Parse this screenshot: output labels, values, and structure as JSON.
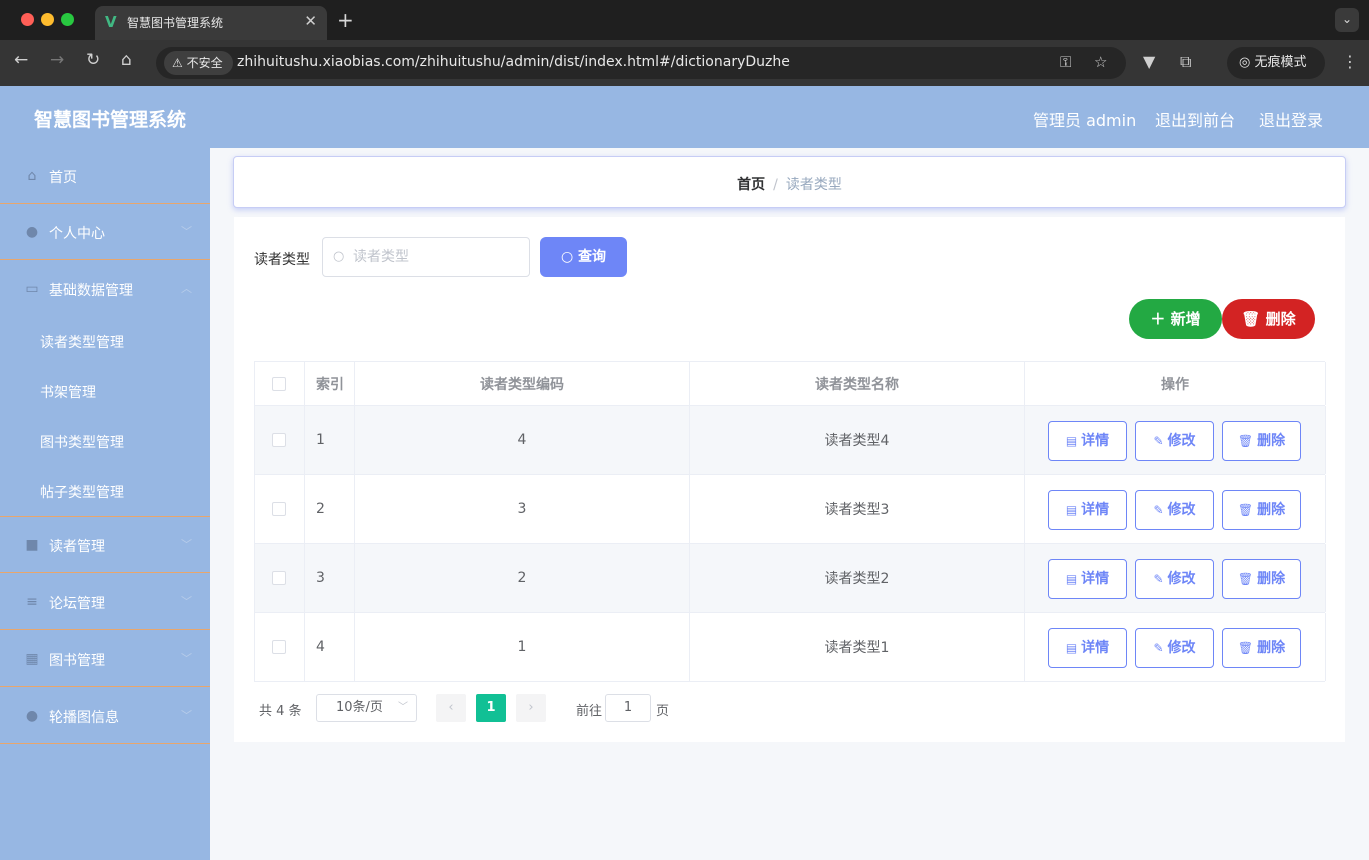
{
  "browser": {
    "tab_title": "智慧图书管理系统",
    "tab_icon": "vue-logo-icon",
    "new_tab_label": "+",
    "security_label": "不安全",
    "url": "zhihuitushu.xiaobias.com/zhihuitushu/admin/dist/index.html#/dictionaryDuzhe",
    "incognito_label": "无痕模式"
  },
  "header": {
    "title": "智慧图书管理系统",
    "user_label": "管理员 admin",
    "back_front_label": "退出到前台",
    "logout_label": "退出登录",
    "bg_color": "#97b7e3"
  },
  "sidebar": {
    "items": [
      {
        "label": "首页",
        "icon": "home-icon"
      },
      {
        "label": "个人中心",
        "icon": "user-icon"
      },
      {
        "label": "基础数据管理",
        "icon": "chat-icon"
      },
      {
        "label": "读者管理",
        "icon": "briefcase-icon"
      },
      {
        "label": "论坛管理",
        "icon": "list-icon"
      },
      {
        "label": "图书管理",
        "icon": "grid-icon"
      },
      {
        "label": "轮播图信息",
        "icon": "bulb-icon"
      }
    ],
    "sub_items": [
      {
        "label": "读者类型管理"
      },
      {
        "label": "书架管理"
      },
      {
        "label": "图书类型管理"
      },
      {
        "label": "帖子类型管理"
      }
    ]
  },
  "breadcrumb": {
    "home": "首页",
    "separator": "/",
    "current": "读者类型"
  },
  "search": {
    "label": "读者类型",
    "placeholder": "读者类型",
    "value": "",
    "query_label": "查询"
  },
  "actions": {
    "add_label": "新增",
    "delete_label": "删除",
    "add_color": "#23a943",
    "delete_color": "#d32323"
  },
  "table": {
    "columns": [
      "索引",
      "读者类型编码",
      "读者类型名称",
      "操作"
    ],
    "rows": [
      {
        "index": "1",
        "code": "4",
        "name": "读者类型4"
      },
      {
        "index": "2",
        "code": "3",
        "name": "读者类型3"
      },
      {
        "index": "3",
        "code": "2",
        "name": "读者类型2"
      },
      {
        "index": "4",
        "code": "1",
        "name": "读者类型1"
      }
    ],
    "op_labels": {
      "detail": "详情",
      "edit": "修改",
      "delete": "删除"
    }
  },
  "pagination": {
    "total_text": "共 4 条",
    "page_size": "10条/页",
    "current_page": "1",
    "goto_label": "前往",
    "goto_value": "1",
    "page_suffix": "页",
    "active_color": "#11c095"
  }
}
